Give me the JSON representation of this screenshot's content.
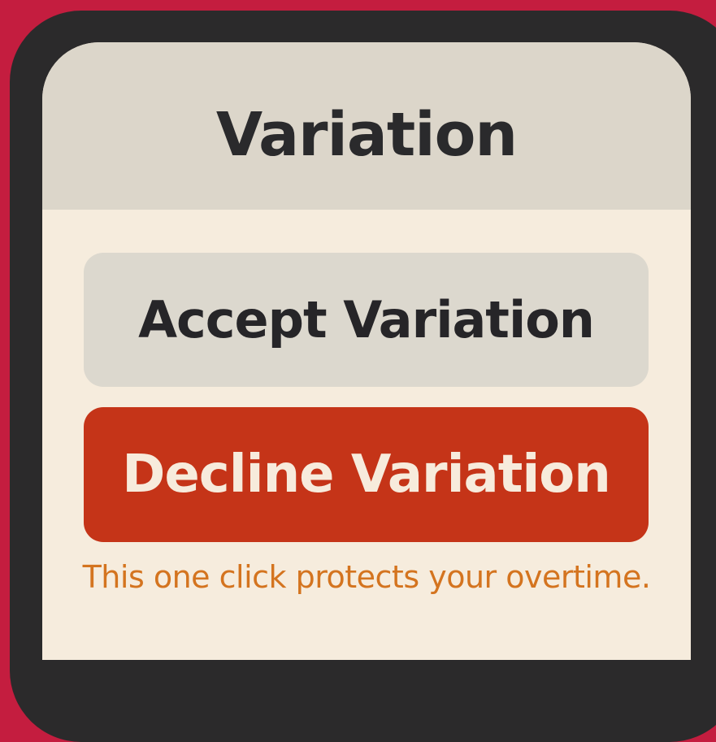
{
  "header": {
    "title": "Variation"
  },
  "actions": {
    "accept_label": "Accept Variation",
    "decline_label": "Decline Variation"
  },
  "note": {
    "text": "This one click protects your overtime."
  },
  "colors": {
    "background": "#c41d3f",
    "frame": "#2b2a2b",
    "header": "#dcd6ca",
    "screen": "#f6ecdd",
    "accept_button": "#dcd8ce",
    "decline_button": "#c53418",
    "note_text": "#d4741f"
  }
}
